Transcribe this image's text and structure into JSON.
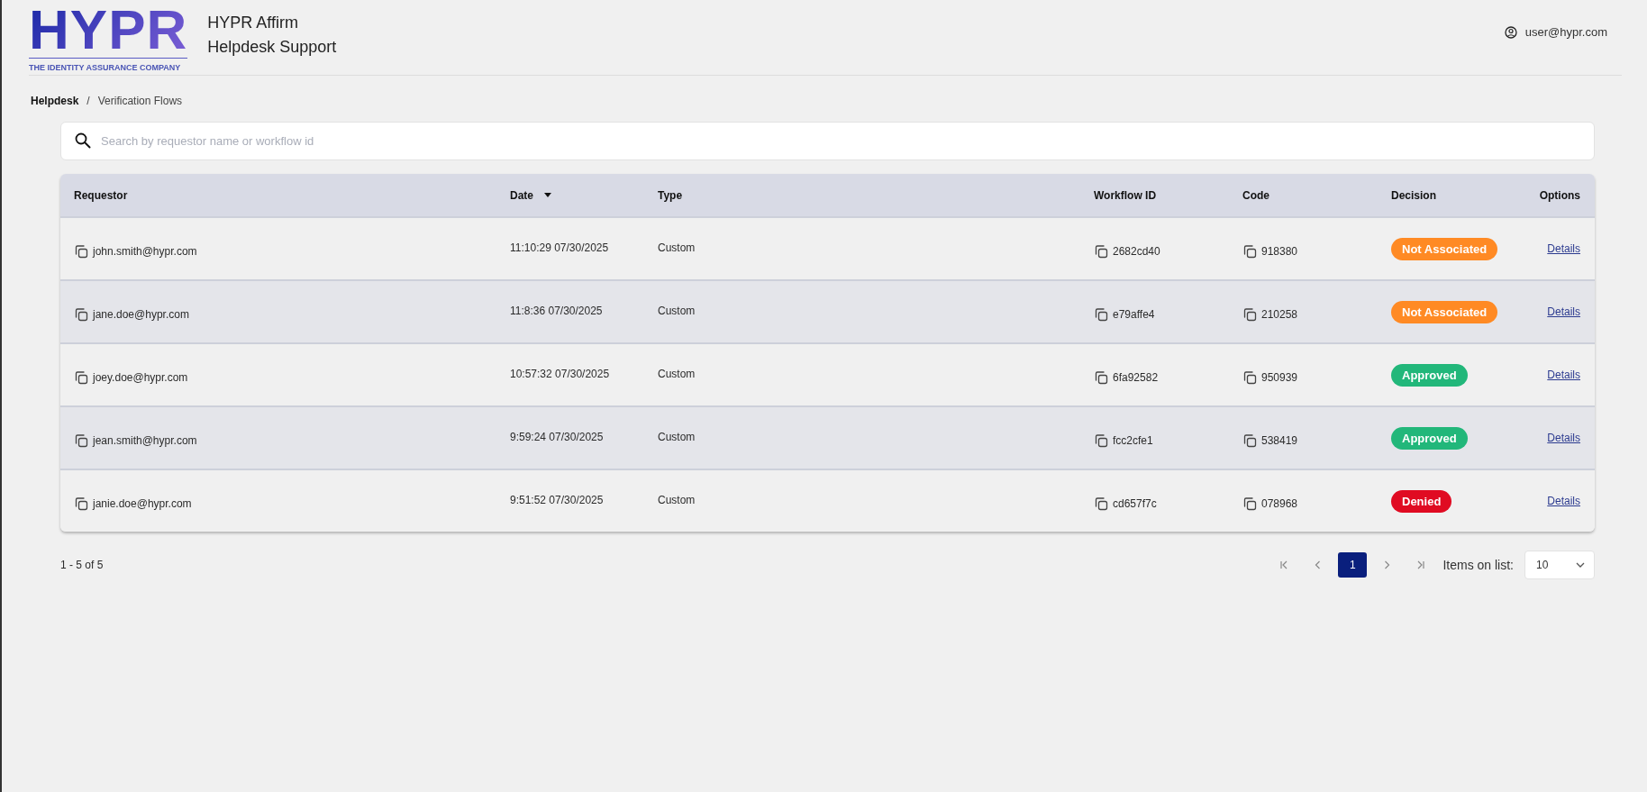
{
  "header": {
    "logo": {
      "wordmark": "HYPR",
      "tagline": "THE IDENTITY ASSURANCE COMPANY"
    },
    "title": "HYPR Affirm",
    "subtitle": "Helpdesk Support",
    "user": "user@hypr.com"
  },
  "breadcrumb": {
    "items": [
      "Helpdesk",
      "Verification Flows"
    ],
    "separator": "/"
  },
  "search": {
    "placeholder": "Search by requestor name or workflow id"
  },
  "table": {
    "columns": [
      {
        "label": "Requestor",
        "sorted": false
      },
      {
        "label": "Date",
        "sorted": true
      },
      {
        "label": "Type",
        "sorted": false
      },
      {
        "label": "Workflow ID",
        "sorted": false
      },
      {
        "label": "Code",
        "sorted": false
      },
      {
        "label": "Decision",
        "sorted": false
      },
      {
        "label": "Options",
        "sorted": false
      }
    ],
    "rows": [
      {
        "requestor": "john.smith@hypr.com",
        "date": "11:10:29 07/30/2025",
        "type": "Custom",
        "workflow_id": "2682cd40",
        "code": "918380",
        "decision": {
          "label": "Not Associated",
          "color": "#ff8a24"
        },
        "option": "Details"
      },
      {
        "requestor": "jane.doe@hypr.com",
        "date": "11:8:36 07/30/2025",
        "type": "Custom",
        "workflow_id": "e79affe4",
        "code": "210258",
        "decision": {
          "label": "Not Associated",
          "color": "#ff8a24"
        },
        "option": "Details"
      },
      {
        "requestor": "joey.doe@hypr.com",
        "date": "10:57:32 07/30/2025",
        "type": "Custom",
        "workflow_id": "6fa92582",
        "code": "950939",
        "decision": {
          "label": "Approved",
          "color": "#22b77a"
        },
        "option": "Details"
      },
      {
        "requestor": "jean.smith@hypr.com",
        "date": "9:59:24 07/30/2025",
        "type": "Custom",
        "workflow_id": "fcc2cfe1",
        "code": "538419",
        "decision": {
          "label": "Approved",
          "color": "#22b77a"
        },
        "option": "Details"
      },
      {
        "requestor": "janie.doe@hypr.com",
        "date": "9:51:52 07/30/2025",
        "type": "Custom",
        "workflow_id": "cd657f7c",
        "code": "078968",
        "decision": {
          "label": "Denied",
          "color": "#e00b22"
        },
        "option": "Details"
      }
    ]
  },
  "pagination": {
    "summary": "1 - 5 of 5",
    "pages": [
      {
        "label": "1",
        "selected": true
      }
    ],
    "items_label": "Items on list:",
    "items_value": "10"
  }
}
